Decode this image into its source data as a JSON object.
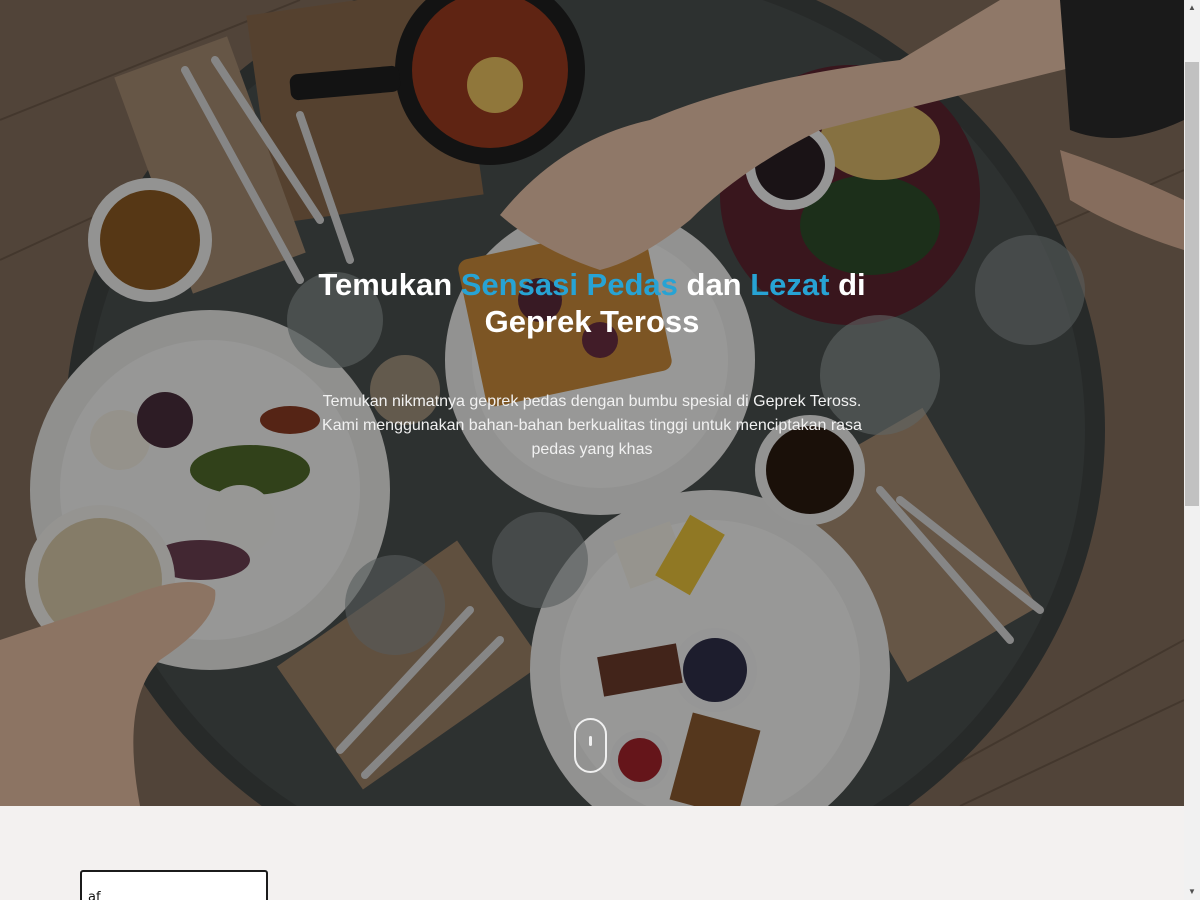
{
  "hero": {
    "title_part1": "Temukan ",
    "title_accent1": "Sensasi Pedas",
    "title_part2": " dan ",
    "title_accent2": "Lezat",
    "title_part3": " di Geprek Teross",
    "description": "Temukan nikmatnya geprek pedas dengan bumbu spesial di Geprek Teross. Kami menggunakan bahan-bahan berkualitas tinggi untuk menciptakan rasa pedas yang khas",
    "background_image": "overhead photo of breakfast dishes on a round table",
    "scroll_indicator_icon": "mouse-scroll-icon"
  },
  "form": {
    "text_input_value": "af"
  },
  "scrollbar": {
    "up_arrow": "▲",
    "down_arrow": "▼"
  },
  "colors": {
    "accent": "#27a3d4",
    "page_background": "#f3f1f0"
  }
}
